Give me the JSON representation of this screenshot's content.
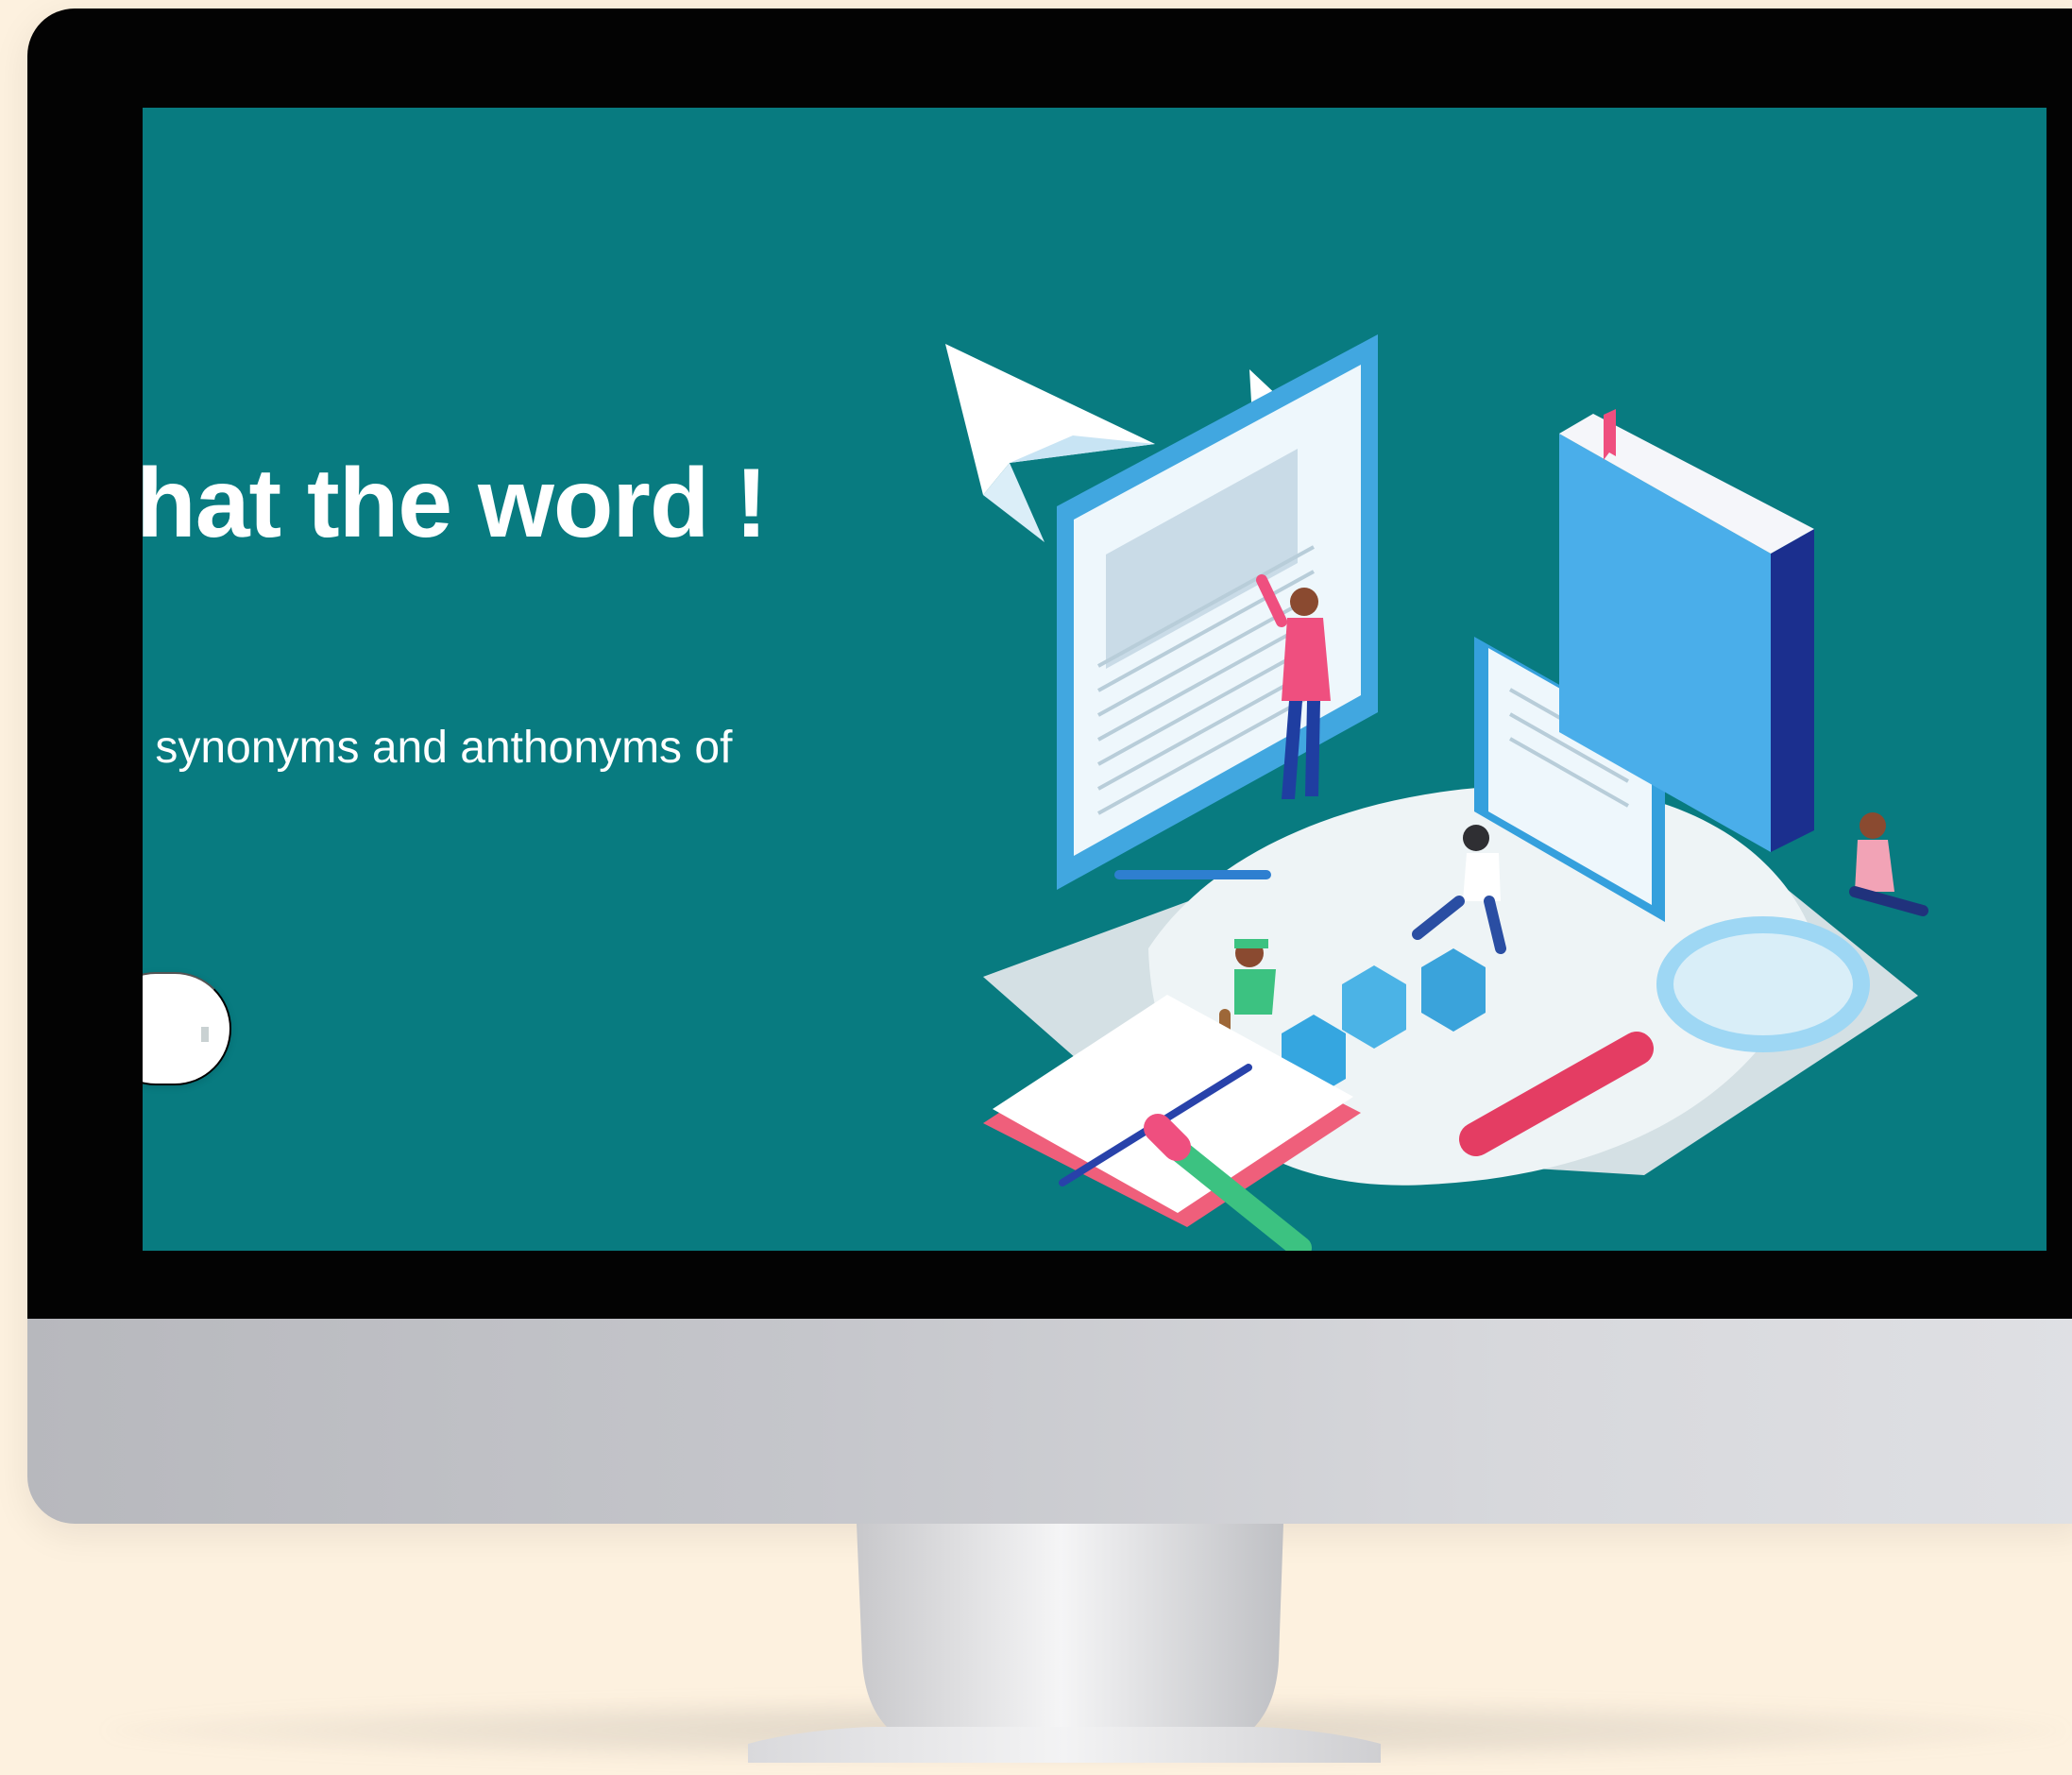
{
  "page": {
    "background": "#fdf1df"
  },
  "monitor": {
    "bezel_color": "#030303",
    "chin_color": "#c5c6cb"
  },
  "screen": {
    "background": "#087b80",
    "hero": {
      "title": "What the word !",
      "subtitle": "ning, synonyms and anthonyms of",
      "cta_label": ""
    }
  },
  "illustration": {
    "icons": [
      "paper-plane-icon",
      "document-board-icon",
      "book-stack-icon",
      "magnifier-icon",
      "pencil-icon"
    ],
    "accent_colors": {
      "blue": "#2f9ddd",
      "pink": "#ef4f7f",
      "green": "#3cc281"
    }
  }
}
